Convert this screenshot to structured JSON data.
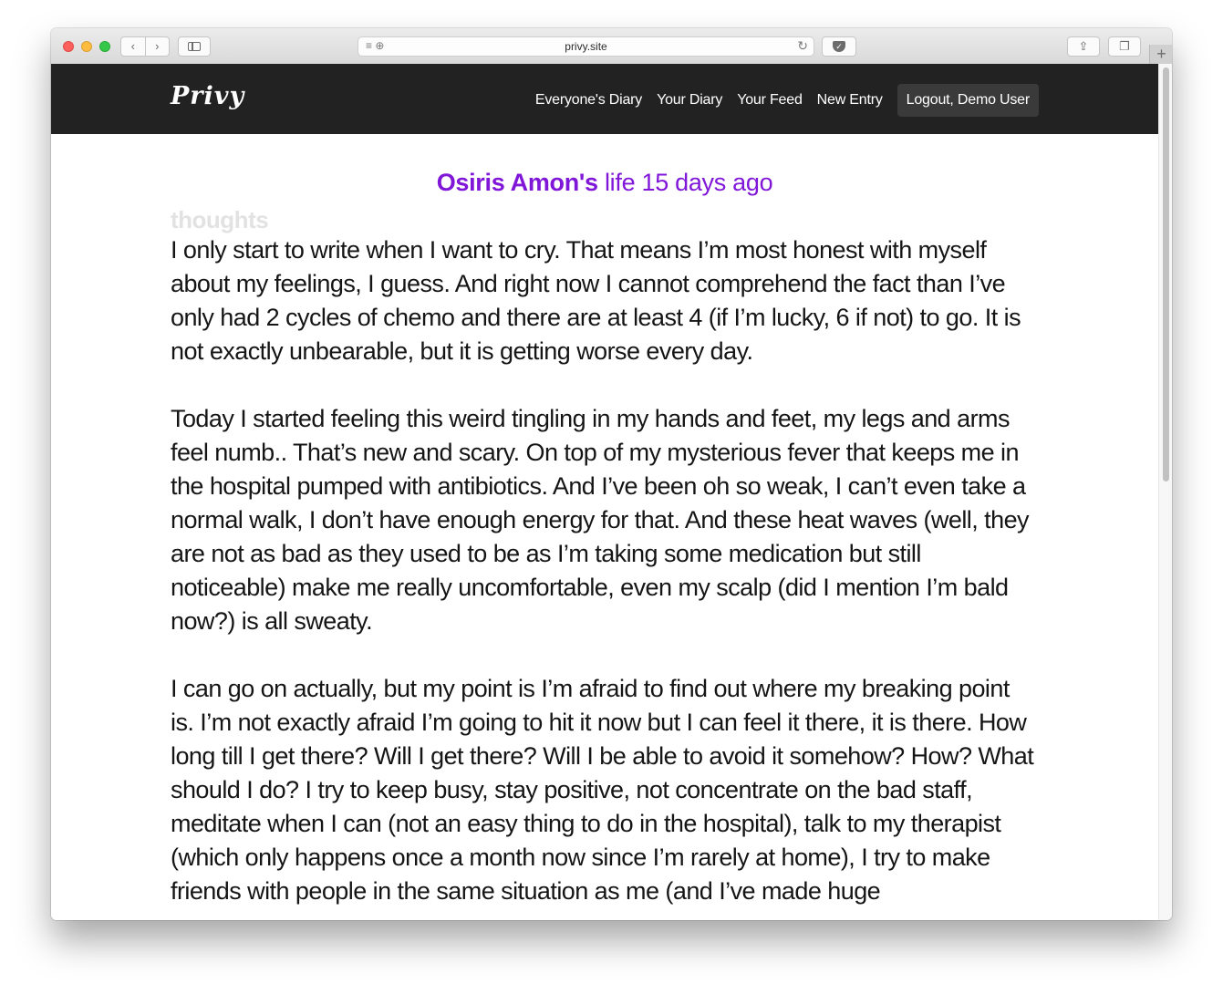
{
  "browser": {
    "url": "privy.site",
    "back_glyph": "‹",
    "forward_glyph": "›",
    "reload_glyph": "↻",
    "new_tab_glyph": "+",
    "share_glyph": "⇪",
    "tabs_glyph": "❐",
    "reader_glyph": "≡ ⊕",
    "pocket_glyph": "✓"
  },
  "navbar": {
    "logo": "Privy",
    "links": [
      "Everyone's Diary",
      "Your Diary",
      "Your Feed",
      "New Entry"
    ],
    "logout": "Logout, Demo User"
  },
  "entry": {
    "author": "Osiris Amon's",
    "title_rest": "life 15 days ago",
    "category": "thoughts",
    "paragraphs": [
      "I only start to write when I want to cry. That means I’m most honest with myself about my feelings, I guess. And right now I cannot comprehend the fact than I’ve only had 2 cycles of chemo and there are at least 4 (if I’m lucky, 6 if not) to go. It is not exactly unbearable, but it is getting worse every day.",
      "Today I started feeling this weird tingling in my hands and feet, my legs and arms feel numb.. That’s new and scary. On top of my mysterious fever that keeps me in the hospital pumped with antibiotics. And I’ve been oh so weak, I can’t even take a normal walk, I don’t have enough energy for that. And these heat waves (well, they are not as bad as they used to be as I’m taking some medication but still noticeable) make me really uncomfortable, even my scalp (did I mention I’m bald now?) is all sweaty.",
      "I can go on actually, but my point is I’m afraid to find out where my breaking point is. I’m not exactly afraid I’m going to hit it now but I can feel it there, it is there. How long till I get there? Will I get there? Will I be able to avoid it somehow? How? What should I do? I try to keep busy, stay positive, not concentrate on the bad staff, meditate when I can (not an easy thing to do in the hospital), talk to my therapist (which only happens once a month now since I’m rarely at home), I try to make friends with people in the same situation as me (and I’ve made huge"
    ]
  },
  "colors": {
    "navbar_bg": "#222222",
    "accent_purple": "#7f16d8",
    "category_gray": "#e2e2e2",
    "body_text": "#151515"
  }
}
